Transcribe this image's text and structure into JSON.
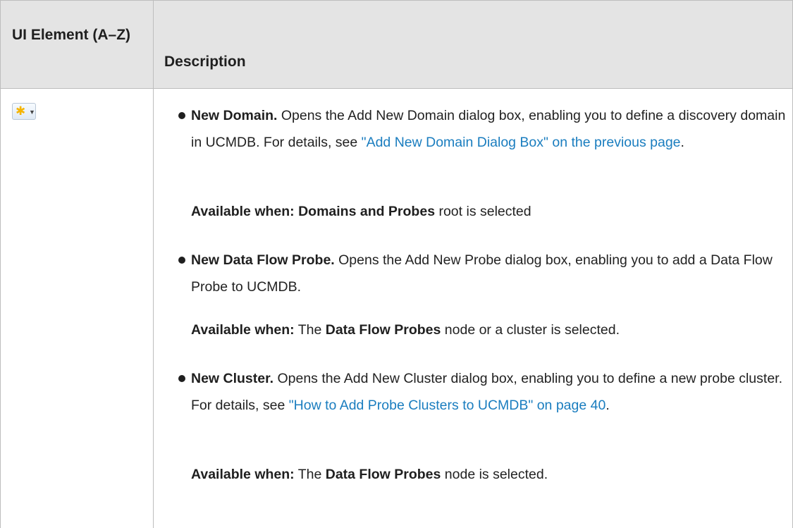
{
  "table": {
    "header": {
      "col1": "UI Element (A–Z)",
      "col2": "Description"
    },
    "row": {
      "icon": "new-star-dropdown-icon",
      "items": [
        {
          "title": "New Domain.",
          "text_before": " Opens the Add New Domain dialog box, enabling you to define a discovery domain in UCMDB. For details, see ",
          "link": "\"Add New Domain Dialog Box\" on the previous page",
          "text_after": ".",
          "avail_label": "Available when:",
          "avail_bold2": " Domains and Probes",
          "avail_rest": " root is selected"
        },
        {
          "title": "New Data Flow Probe.",
          "text_before": " Opens the Add New Probe dialog box, enabling you to add a Data Flow Probe to UCMDB.",
          "avail_label": "Available when:",
          "avail_plain": " The ",
          "avail_bold2": "Data Flow Probes",
          "avail_rest": " node or a cluster is selected."
        },
        {
          "title": "New Cluster.",
          "text_before": " Opens the Add New Cluster dialog box, enabling you to define a new probe cluster. For details, see ",
          "link": "\"How to Add Probe Clusters to UCMDB\" on page 40",
          "text_after": ".",
          "avail_label": "Available when:",
          "avail_plain": " The ",
          "avail_bold2": "Data Flow Probes",
          "avail_rest": " node is selected."
        }
      ]
    }
  },
  "colors": {
    "header_bg": "#e4e4e4",
    "border": "#bdbdbd",
    "link": "#1a7dbf"
  }
}
